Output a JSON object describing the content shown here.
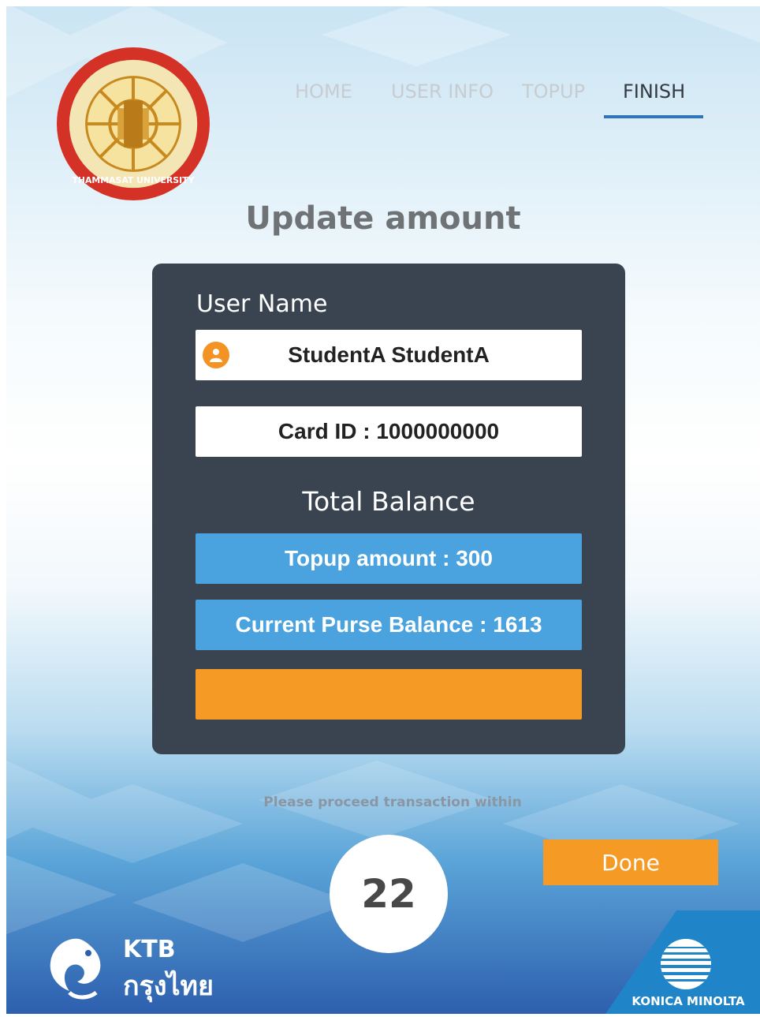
{
  "nav": {
    "items": [
      {
        "label": "HOME",
        "active": false
      },
      {
        "label": "USER INFO",
        "active": false
      },
      {
        "label": "TOPUP",
        "active": false
      },
      {
        "label": "FINISH",
        "active": true
      }
    ]
  },
  "logo": {
    "name": "thammasat-university-seal",
    "text": "THAMMASAT UNIVERSITY"
  },
  "page": {
    "title": "Update amount"
  },
  "panel": {
    "user_label": "User Name",
    "user_name": "StudentA StudentA",
    "card_id": "Card ID : 1000000000",
    "balance_title": "Total Balance",
    "topup_amount": "Topup amount : 300",
    "current_balance": "Current Purse Balance : 1613",
    "orange_box_text": ""
  },
  "footer": {
    "proceed_text": "Please proceed transaction within",
    "countdown": "22",
    "done_label": "Done",
    "bank_logo_line1": "KTB",
    "bank_logo_line2": "กรุงไทย",
    "vendor_logo": "KONICA MINOLTA"
  },
  "colors": {
    "accent_blue": "#4aa3de",
    "accent_orange": "#f59a24",
    "panel_bg": "#3a4450",
    "nav_active_underline": "#2f76b8"
  }
}
